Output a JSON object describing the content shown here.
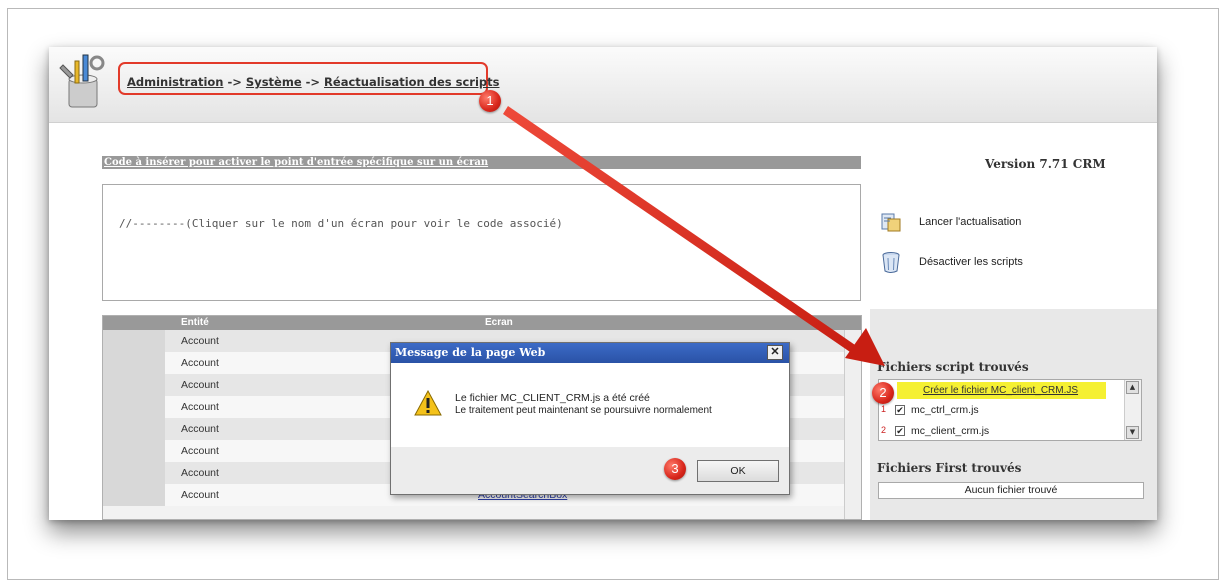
{
  "breadcrumb": {
    "part1": "Administration",
    "sep": " -> ",
    "part2": "Système",
    "part3": "Réactualisation des scripts"
  },
  "callouts": {
    "one": "1",
    "two": "2",
    "three": "3"
  },
  "code_section": {
    "title": "Code à insérer pour activer le point d'entrée spécifique sur un écran",
    "placeholder": "//--------(Cliquer sur le nom d'un écran pour voir le code associé)"
  },
  "version": "Version 7.71 CRM",
  "actions": {
    "refresh_label": "Lancer l'actualisation",
    "disable_label": "Désactiver les scripts"
  },
  "scripts_found": {
    "title": "Fichiers script trouvés",
    "create_link": "Créer le fichier MC_client_CRM.JS",
    "rows": [
      {
        "num": "1",
        "checked": "✔",
        "name": "mc_ctrl_crm.js"
      },
      {
        "num": "2",
        "checked": "✔",
        "name": "mc_client_crm.js"
      }
    ]
  },
  "first_found": {
    "title": "Fichiers First trouvés",
    "empty_text": "Aucun fichier trouvé"
  },
  "table": {
    "col_entite": "Entité",
    "col_ecran": "Ecran",
    "rows": [
      {
        "entite": "Account",
        "ecran": ""
      },
      {
        "entite": "Account",
        "ecran": ""
      },
      {
        "entite": "Account",
        "ecran": ""
      },
      {
        "entite": "Account",
        "ecran": ""
      },
      {
        "entite": "Account",
        "ecran": ""
      },
      {
        "entite": "Account",
        "ecran": ""
      },
      {
        "entite": "Account",
        "ecran": ""
      },
      {
        "entite": "Account",
        "ecran": "AccountSearchBox"
      }
    ]
  },
  "dialog": {
    "title": "Message de la page Web",
    "close": "✕",
    "line1": "Le fichier MC_CLIENT_CRM.js a été créé",
    "line2": "Le traitement peut maintenant se poursuivre normalement",
    "ok": "OK"
  },
  "colors": {
    "callout_red": "#d8261b",
    "highlight_yellow": "#f5f032",
    "header_gray": "#999999"
  }
}
